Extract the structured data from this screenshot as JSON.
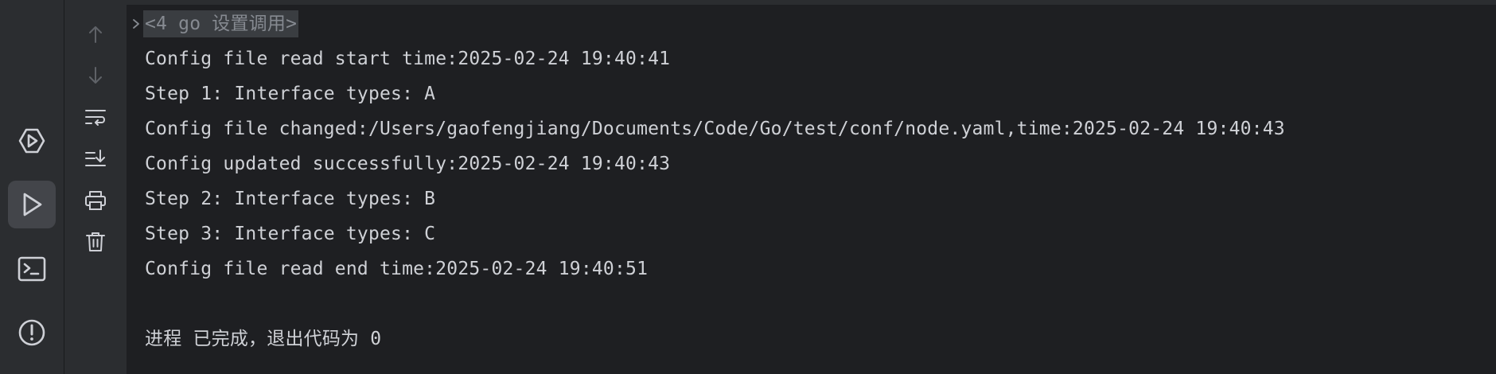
{
  "console": {
    "header": "<4 go 设置调用>",
    "lines": [
      "Config file read start time:2025-02-24 19:40:41",
      "Step 1: Interface types: A",
      "Config file changed:/Users/gaofengjiang/Documents/Code/Go/test/conf/node.yaml,time:2025-02-24 19:40:43",
      "Config updated successfully:2025-02-24 19:40:43",
      "Step 2: Interface types: B",
      "Step 3: Interface types: C",
      "Config file read end time:2025-02-24 19:40:51",
      "",
      "进程 已完成，退出代码为 0"
    ]
  },
  "left_strip": {
    "items": [
      {
        "icon": "services-icon",
        "active": false
      },
      {
        "icon": "run-icon",
        "active": true
      },
      {
        "icon": "terminal-icon",
        "active": false
      },
      {
        "icon": "problems-icon",
        "active": false
      }
    ]
  },
  "gutter": {
    "items": [
      {
        "icon": "arrow-up-icon"
      },
      {
        "icon": "arrow-down-icon"
      },
      {
        "icon": "soft-wrap-icon"
      },
      {
        "icon": "scroll-to-end-icon"
      },
      {
        "icon": "print-icon"
      },
      {
        "icon": "trash-icon"
      }
    ]
  },
  "colors": {
    "background": "#1e1f22",
    "panel": "#2b2d30",
    "text": "#cfd1d6",
    "muted_text": "#868a91",
    "icon": "#ced0d6",
    "disabled_icon": "#5f6267"
  }
}
